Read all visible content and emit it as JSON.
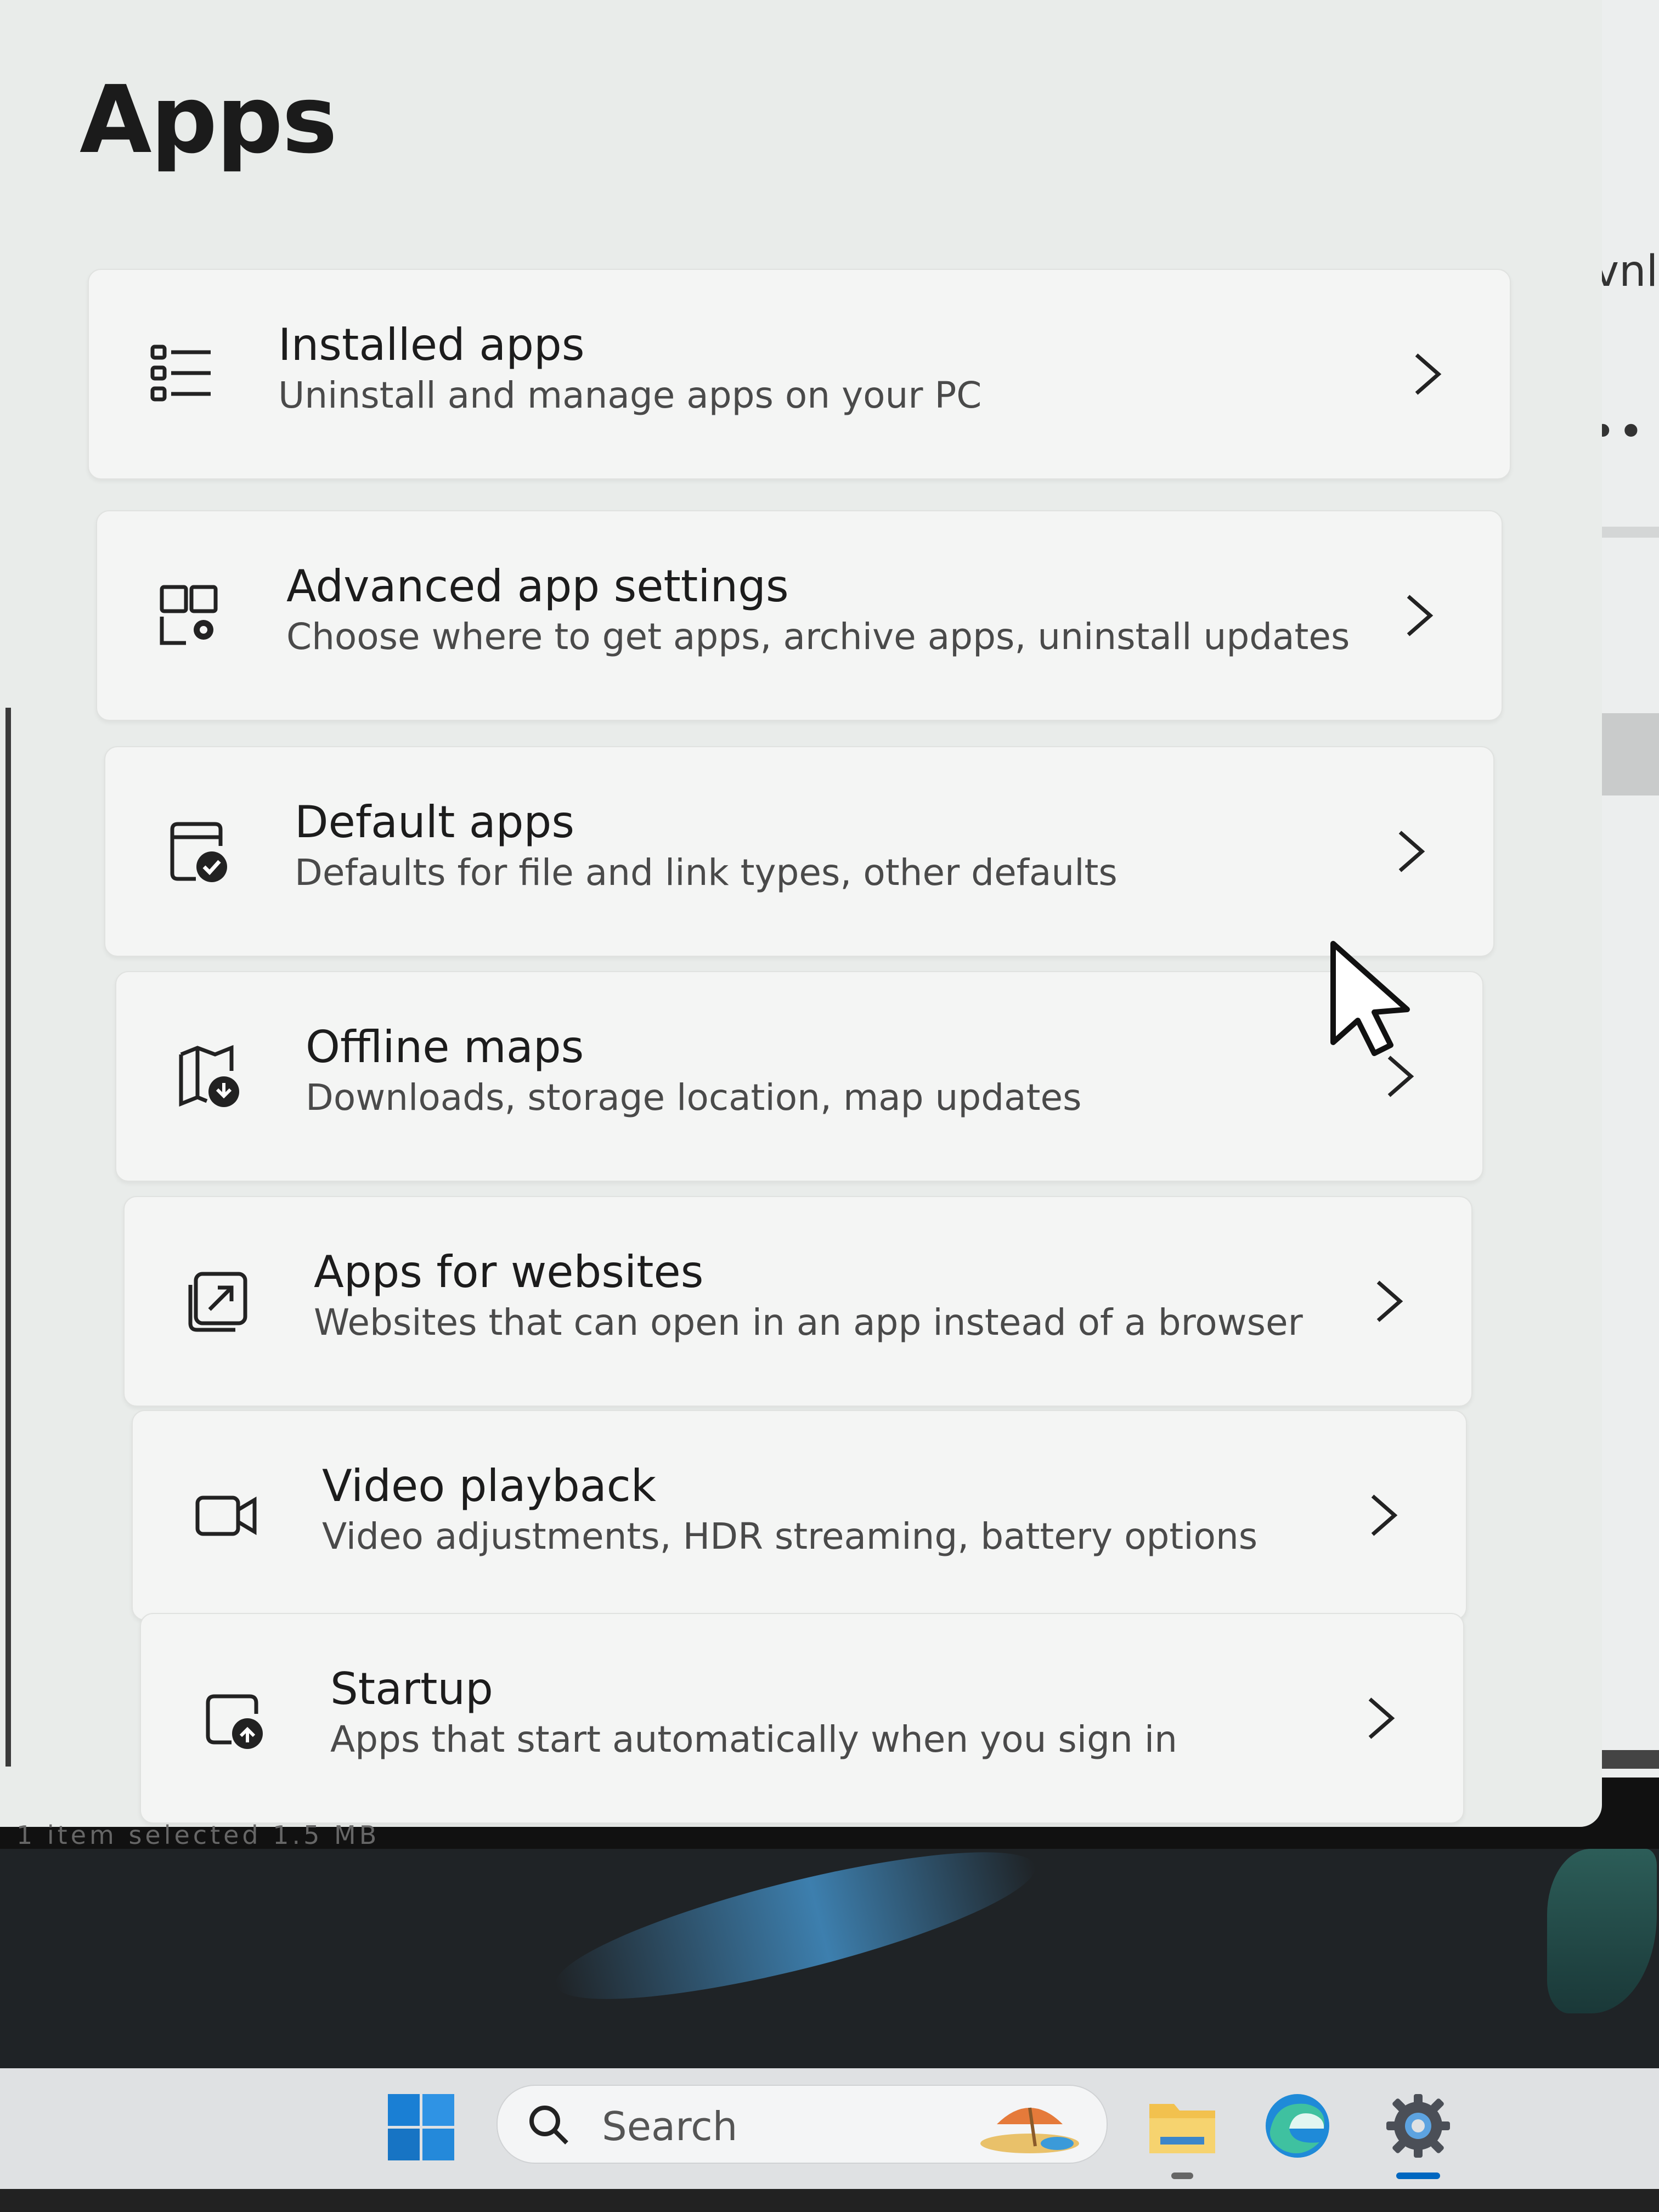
{
  "page": {
    "title": "Apps"
  },
  "items": [
    {
      "title": "Installed apps",
      "subtitle": "Uninstall and manage apps on your PC",
      "icon": "installed-apps-icon"
    },
    {
      "title": "Advanced app settings",
      "subtitle": "Choose where to get apps, archive apps, uninstall updates",
      "icon": "advanced-app-settings-icon"
    },
    {
      "title": "Default apps",
      "subtitle": "Defaults for file and link types, other defaults",
      "icon": "default-apps-icon"
    },
    {
      "title": "Offline maps",
      "subtitle": "Downloads, storage location, map updates",
      "icon": "offline-maps-icon"
    },
    {
      "title": "Apps for websites",
      "subtitle": "Websites that can open in an app instead of a browser",
      "icon": "apps-for-websites-icon"
    },
    {
      "title": "Video playback",
      "subtitle": "Video adjustments, HDR streaming, battery options",
      "icon": "video-playback-icon"
    },
    {
      "title": "Startup",
      "subtitle": "Apps that start automatically when you sign in",
      "icon": "startup-icon"
    }
  ],
  "background": {
    "partial_text": "vnl",
    "dots": "••",
    "status_text": "1 item selected   1.5 MB"
  },
  "taskbar": {
    "search_placeholder": "Search"
  },
  "colors": {
    "accent": "#0067c0",
    "edge_blue": "#1f8ad8",
    "folder_yellow": "#f2c14e"
  }
}
